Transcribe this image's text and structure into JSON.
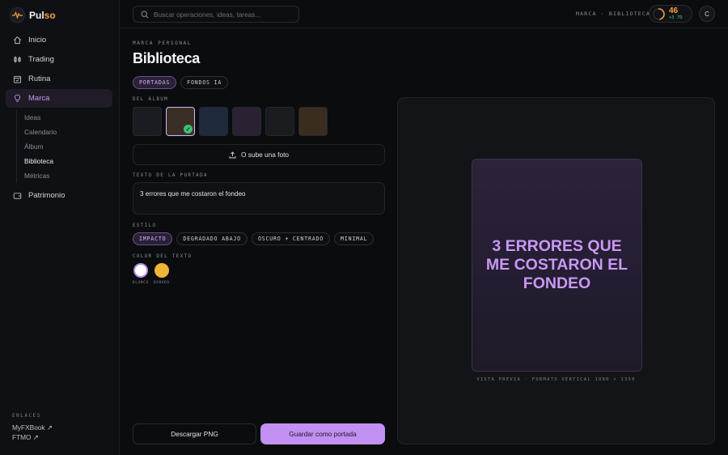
{
  "app": {
    "name_main": "Pul",
    "name_accent": "so"
  },
  "nav": {
    "items": [
      {
        "label": "Inicio",
        "icon": "home-icon"
      },
      {
        "label": "Trading",
        "icon": "candles-icon"
      },
      {
        "label": "Rutina",
        "icon": "calendar-check-icon"
      },
      {
        "label": "Marca",
        "icon": "lightbulb-icon",
        "active": true
      },
      {
        "label": "Patrimonio",
        "icon": "wallet-icon"
      }
    ],
    "sub_items": [
      {
        "label": "Ideas"
      },
      {
        "label": "Calendario"
      },
      {
        "label": "Álbum"
      },
      {
        "label": "Biblioteca",
        "active": true
      },
      {
        "label": "Métricas"
      }
    ]
  },
  "links": {
    "title": "ENLACES",
    "items": [
      "MyFXBook ↗",
      "FTMO ↗"
    ]
  },
  "topbar": {
    "search_placeholder": "Buscar operaciones, ideas, tareas...",
    "breadcrumb": "MARCA · BIBLIOTECA",
    "score": "46",
    "score_delta": "+3 7D",
    "score_progress": 0.46,
    "avatar_initial": "C"
  },
  "page": {
    "eyebrow": "MARCA PERSONAL",
    "title": "Biblioteca",
    "tabs": [
      {
        "label": "PORTADAS",
        "active": true
      },
      {
        "label": "FONDOS IA"
      }
    ],
    "album_label": "DEL ÁLBUM",
    "album_selected_index": 1,
    "album_colors": [
      "#1a1c21",
      "#3a2f26",
      "#1e2a3c",
      "#2a2233",
      "#1b1c20",
      "#3a2d20"
    ],
    "upload_label": "O sube una foto",
    "cover_text_label": "TEXTO DE LA PORTADA",
    "cover_text_value": "3 errores que me costaron el fondeo",
    "style_label": "ESTILO",
    "styles": [
      {
        "label": "IMPACTO",
        "active": true
      },
      {
        "label": "DEGRADADO ABAJO"
      },
      {
        "label": "OSCURO + CENTRADO"
      },
      {
        "label": "MINIMAL"
      }
    ],
    "color_label": "COLOR DEL TEXTO",
    "colors": [
      {
        "label": "BLANCO",
        "hex": "#ffffff",
        "selected": true
      },
      {
        "label": "DORADO",
        "hex": "#f0b43a"
      }
    ],
    "download_button": "Descargar PNG",
    "save_button": "Guardar como portada"
  },
  "preview": {
    "cover_title": "3 ERRORES QUE ME COSTARON EL FONDEO",
    "caption": "VISTA PREVIA · FORMATO VERTICAL 1080 × 1350"
  }
}
